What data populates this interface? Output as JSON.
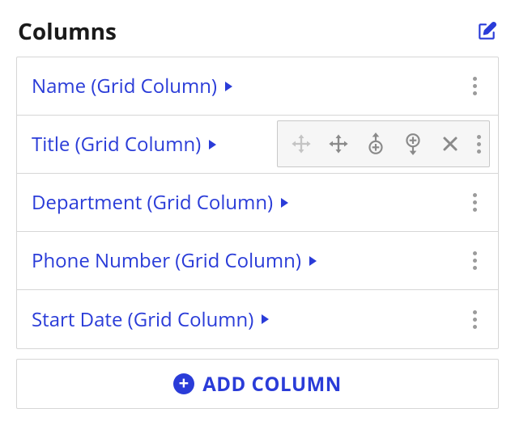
{
  "header": {
    "title": "Columns"
  },
  "columns": [
    {
      "label": "Name (Grid Column)",
      "toolbar": false
    },
    {
      "label": "Title (Grid Column)",
      "toolbar": true
    },
    {
      "label": "Department (Grid Column)",
      "toolbar": false
    },
    {
      "label": "Phone Number (Grid Column)",
      "toolbar": false
    },
    {
      "label": "Start Date (Grid Column)",
      "toolbar": false
    }
  ],
  "addButton": {
    "label": "ADD COLUMN"
  },
  "colors": {
    "accent": "#2a3cd8",
    "border": "#d6d6d6",
    "icon": "#8a8a8a"
  }
}
